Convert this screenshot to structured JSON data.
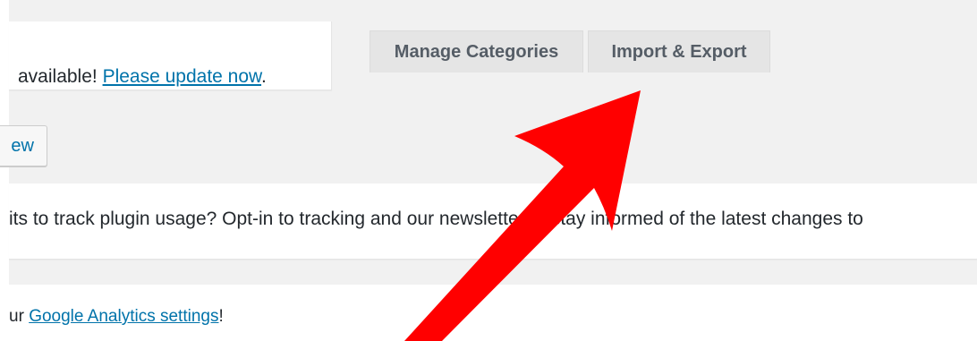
{
  "update_notice": {
    "text_before": "available! ",
    "link": "Please update now",
    "text_after": "."
  },
  "tabs": [
    {
      "label": "Manage Categories"
    },
    {
      "label": "Import & Export"
    }
  ],
  "preview_button": {
    "label": "ew"
  },
  "optin_notice": {
    "text": "its to track plugin usage? Opt-in to tracking and our newsletter to stay informed of the latest changes to"
  },
  "ga_notice": {
    "text_before": "ur ",
    "link": "Google Analytics settings",
    "text_after": "!"
  },
  "annotation": {
    "color": "#ff0000",
    "icon": "red-arrow-icon"
  }
}
